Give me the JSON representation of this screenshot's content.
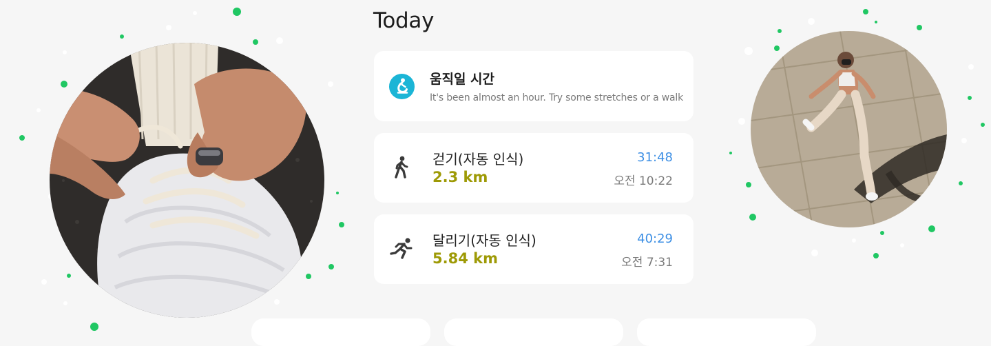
{
  "section": {
    "title": "Today"
  },
  "reminder": {
    "icon": "stretch-person-icon",
    "title": "움직일 시간",
    "message": "It's been almost an hour. Try some stretches or a walk"
  },
  "activities": [
    {
      "icon": "walking-icon",
      "name": "걷기(자동 인식)",
      "distance": "2.3 km",
      "duration": "31:48",
      "time": "오전 10:22"
    },
    {
      "icon": "running-icon",
      "name": "달리기(자동 인식)",
      "distance": "5.84 km",
      "duration": "40:29",
      "time": "오전 7:31"
    }
  ],
  "images": {
    "left": "photo-hands-tying-shoe-with-ring",
    "right": "photo-woman-running"
  },
  "colors": {
    "background": "#f6f6f6",
    "card": "#ffffff",
    "accent_teal": "#1bb5d6",
    "distance_olive": "#9e9a06",
    "duration_blue": "#3d8fe4",
    "dot_green": "#20c763"
  }
}
